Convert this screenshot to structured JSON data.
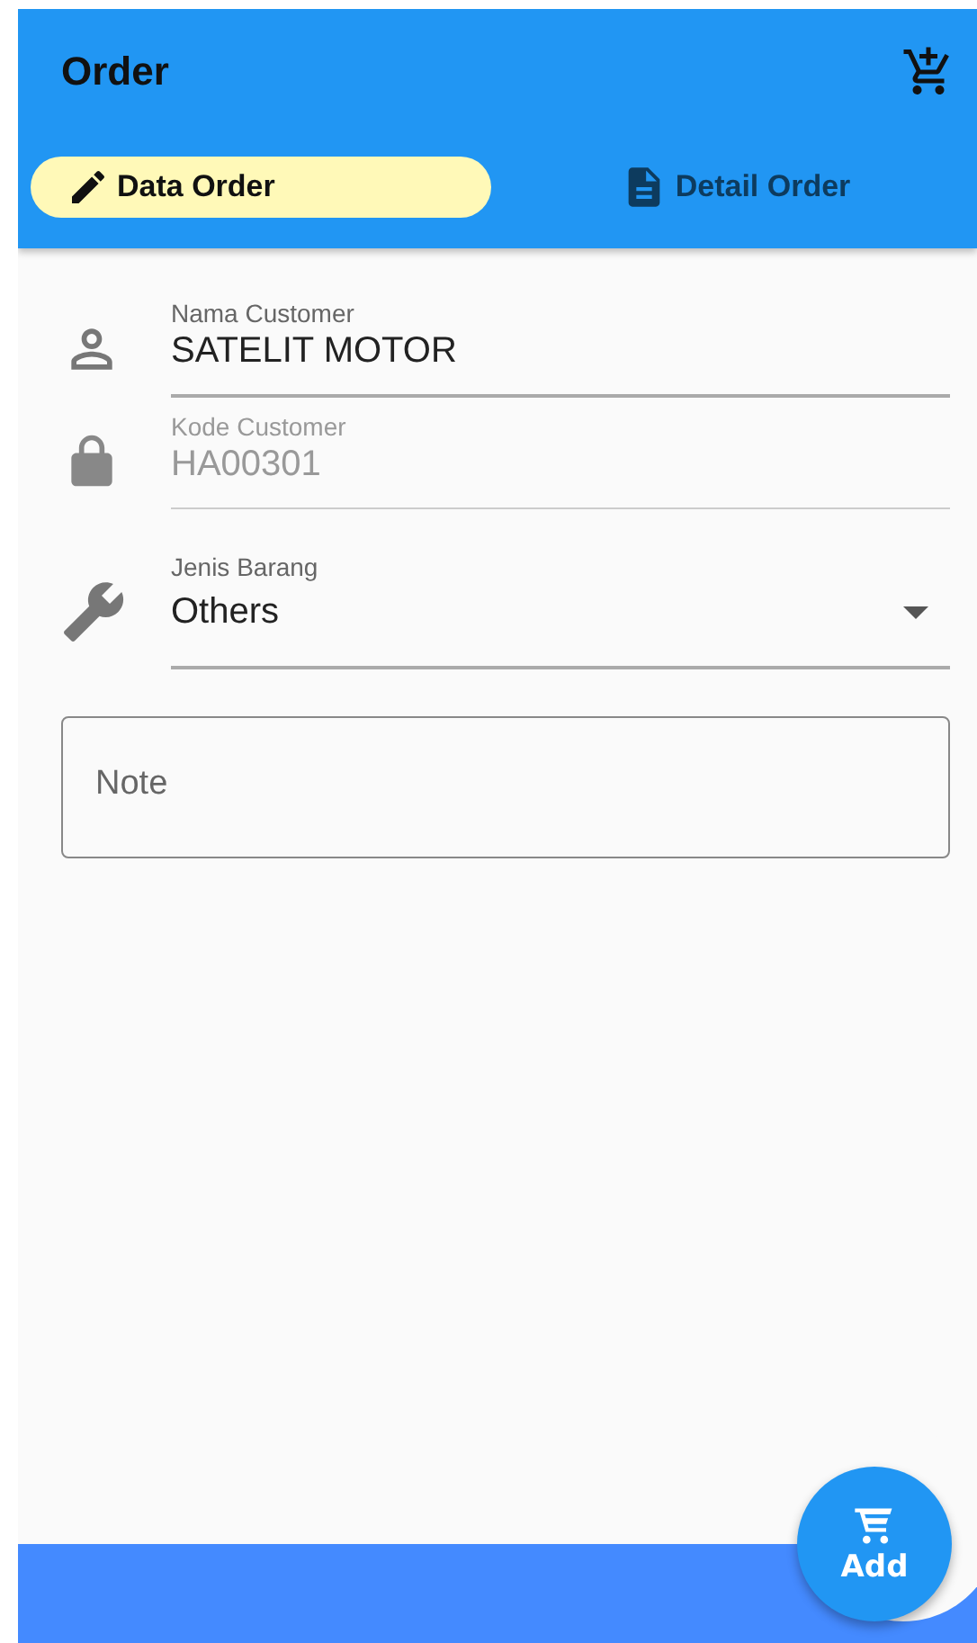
{
  "app_bar": {
    "title": "Order"
  },
  "tabs": [
    {
      "label": "Data Order",
      "selected": true
    },
    {
      "label": "Detail Order",
      "selected": false
    }
  ],
  "fields": [
    {
      "kind": "text",
      "label": "Nama Customer",
      "value": "SATELIT MOTOR",
      "disabled": false
    },
    {
      "kind": "text",
      "label": "Kode Customer",
      "value": "HA00301",
      "disabled": true
    },
    {
      "kind": "dropdown",
      "label": "Jenis Barang",
      "value": "Others",
      "disabled": false
    }
  ],
  "note": {
    "placeholder": "Note"
  },
  "fab": {
    "label": "Add"
  }
}
